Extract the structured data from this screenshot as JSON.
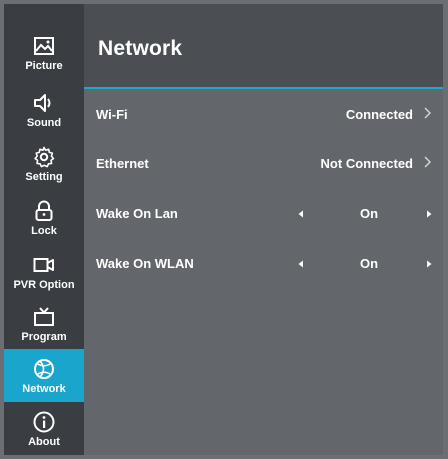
{
  "sidebar": {
    "items": [
      {
        "label": "Picture",
        "icon": "picture-icon"
      },
      {
        "label": "Sound",
        "icon": "speaker-icon"
      },
      {
        "label": "Setting",
        "icon": "gear-icon"
      },
      {
        "label": "Lock",
        "icon": "lock-icon"
      },
      {
        "label": "PVR Option",
        "icon": "camera-icon"
      },
      {
        "label": "Program",
        "icon": "tv-icon"
      },
      {
        "label": "Network",
        "icon": "globe-icon"
      },
      {
        "label": "About",
        "icon": "info-icon"
      }
    ],
    "active_index": 6,
    "active_color": "#1aa6cc"
  },
  "page": {
    "title": "Network"
  },
  "rows": {
    "wifi": {
      "label": "Wi-Fi",
      "value": "Connected"
    },
    "ethernet": {
      "label": "Ethernet",
      "value": "Not Connected"
    },
    "wake_on_lan": {
      "label": "Wake On Lan",
      "value": "On"
    },
    "wake_on_wlan": {
      "label": "Wake On WLAN",
      "value": "On"
    }
  },
  "colors": {
    "accent": "#1ea8cf",
    "sidebar_bg": "#3a3e43",
    "content_bg": "#63676b"
  }
}
